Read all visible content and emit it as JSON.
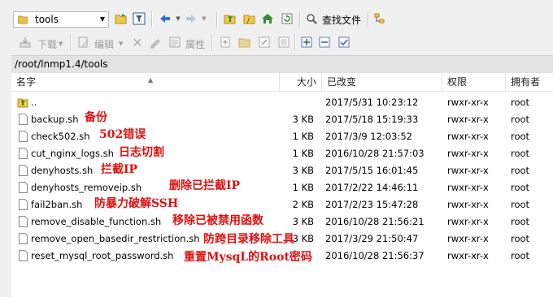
{
  "toolbar1": {
    "location": "tools",
    "find_files_label": "查找文件"
  },
  "toolbar2": {
    "download_label": "下载",
    "edit_label": "编辑",
    "properties_label": "属性"
  },
  "path": "/root/lnmp1.4/tools",
  "columns": {
    "name": "名字",
    "size": "大小",
    "modified": "已改变",
    "permissions": "权限",
    "owner": "拥有者"
  },
  "rows": [
    {
      "name": "..",
      "size": "",
      "modified": "2017/5/31 10:23:12",
      "perm": "rwxr-xr-x",
      "owner": "root",
      "note": "",
      "type": "parent"
    },
    {
      "name": "backup.sh",
      "size": "3 KB",
      "modified": "2017/5/18 15:19:33",
      "perm": "rwxr-xr-x",
      "owner": "root",
      "note": "备份",
      "type": "file"
    },
    {
      "name": "check502.sh",
      "size": "1 KB",
      "modified": "2017/3/9 12:03:52",
      "perm": "rwxr-xr-x",
      "owner": "root",
      "note": "502错误",
      "type": "file"
    },
    {
      "name": "cut_nginx_logs.sh",
      "size": "1 KB",
      "modified": "2016/10/28 21:57:03",
      "perm": "rwxr-xr-x",
      "owner": "root",
      "note": "日志切割",
      "type": "file"
    },
    {
      "name": "denyhosts.sh",
      "size": "3 KB",
      "modified": "2017/5/15 16:01:45",
      "perm": "rwxr-xr-x",
      "owner": "root",
      "note": "拦截IP",
      "type": "file"
    },
    {
      "name": "denyhosts_removeip.sh",
      "size": "1 KB",
      "modified": "2017/2/22 14:46:11",
      "perm": "rwxr-xr-x",
      "owner": "root",
      "note": "删除已拦截IP",
      "type": "file"
    },
    {
      "name": "fail2ban.sh",
      "size": "2 KB",
      "modified": "2017/2/23 15:47:28",
      "perm": "rwxr-xr-x",
      "owner": "root",
      "note": "防暴力破解SSH",
      "type": "file"
    },
    {
      "name": "remove_disable_function.sh",
      "size": "3 KB",
      "modified": "2016/10/28 21:56:21",
      "perm": "rwxr-xr-x",
      "owner": "root",
      "note": "移除已被禁用函数",
      "type": "file"
    },
    {
      "name": "remove_open_basedir_restriction.sh",
      "size": "3 KB",
      "modified": "2017/3/29 21:50:47",
      "perm": "rwxr-xr-x",
      "owner": "root",
      "note": "防跨目录移除工具",
      "type": "file"
    },
    {
      "name": "reset_mysql_root_password.sh",
      "size": "",
      "modified": "2016/10/28 21:56:37",
      "perm": "rwxr-xr-x",
      "owner": "root",
      "note": "重置MysqL的Root密码",
      "type": "file"
    }
  ]
}
